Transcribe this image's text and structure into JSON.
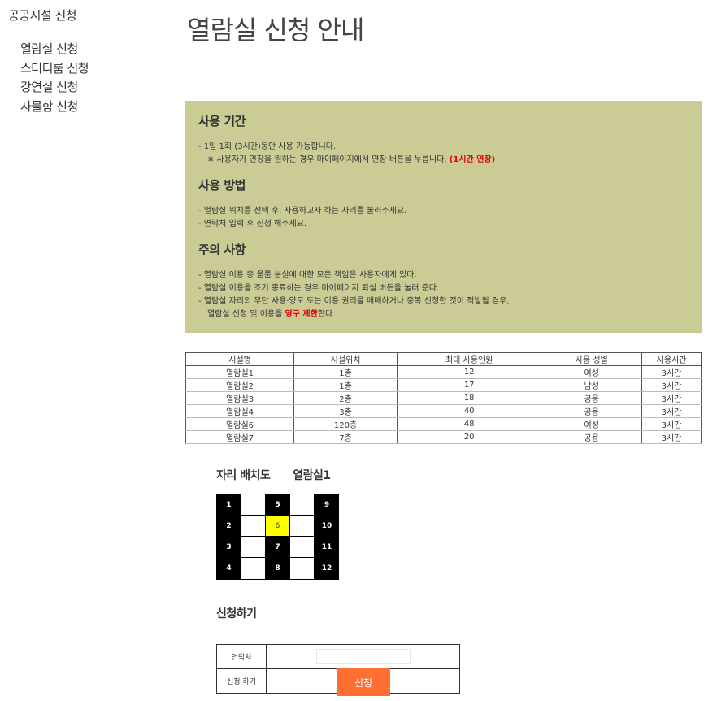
{
  "sidebar": {
    "title": "공공시설 신청",
    "items": [
      {
        "label": "열람실 신청"
      },
      {
        "label": "스터디룸 신청"
      },
      {
        "label": "강연실 신청"
      },
      {
        "label": "사물함 신청"
      }
    ]
  },
  "page": {
    "title": "열람실 신청 안내"
  },
  "info": {
    "period_title": "사용 기간",
    "period_line1": "- 1일 1회 (3시간)동안 사용 가능합니다.",
    "period_line2": "※ 사용자가 연장을 원하는 경우 마이페이지에서 연장 버튼을 누릅니다. ",
    "period_line2_red": "(1시간 연장)",
    "method_title": "사용 방법",
    "method_line1": "- 열람실 위치를 선택 후, 사용하고자 하는 자리를 눌러주세요.",
    "method_line2": "- 연락처 입력 후 신청 해주세요.",
    "caution_title": "주의 사항",
    "caution_line1": "- 열람실 이용 중 물품 분실에 대한 모든 책임은 사용자에게 있다.",
    "caution_line2": "- 열람실 이용을 조기 종료하는 경우 마이페이지 퇴실 버튼을 눌러 준다.",
    "caution_line3": "- 열람실 자리의 무단 사용·양도 또는 이용 권리를 매매하거나 중복 신청한 것이 적발될 경우,",
    "caution_line4a": "열람실 신청 및 이용을 ",
    "caution_line4_red": "영구 제한",
    "caution_line4b": "한다."
  },
  "table": {
    "headers": [
      "시설명",
      "시설위치",
      "최대 사용인원",
      "사용 성별",
      "사용시간"
    ],
    "rows": [
      [
        "열람실1",
        "1층",
        "12",
        "여성",
        "3시간"
      ],
      [
        "열람실2",
        "1층",
        "17",
        "남성",
        "3시간"
      ],
      [
        "열람실3",
        "2층",
        "18",
        "공용",
        "3시간"
      ],
      [
        "열람실4",
        "3층",
        "40",
        "공용",
        "3시간"
      ],
      [
        "열람실6",
        "120층",
        "48",
        "여성",
        "3시간"
      ],
      [
        "열람실7",
        "7층",
        "20",
        "공용",
        "3시간"
      ]
    ]
  },
  "seats": {
    "label": "자리 배치도",
    "room": "열람실1",
    "grid": [
      [
        {
          "n": "1",
          "s": "occupied"
        },
        {
          "n": "",
          "s": "empty"
        },
        {
          "n": "5",
          "s": "occupied"
        },
        {
          "n": "",
          "s": "empty"
        },
        {
          "n": "9",
          "s": "occupied"
        }
      ],
      [
        {
          "n": "2",
          "s": "occupied"
        },
        {
          "n": "",
          "s": "empty"
        },
        {
          "n": "6",
          "s": "selected"
        },
        {
          "n": "",
          "s": "empty"
        },
        {
          "n": "10",
          "s": "occupied"
        }
      ],
      [
        {
          "n": "3",
          "s": "occupied"
        },
        {
          "n": "",
          "s": "empty"
        },
        {
          "n": "7",
          "s": "occupied"
        },
        {
          "n": "",
          "s": "empty"
        },
        {
          "n": "11",
          "s": "occupied"
        }
      ],
      [
        {
          "n": "4",
          "s": "occupied"
        },
        {
          "n": "",
          "s": "empty"
        },
        {
          "n": "8",
          "s": "occupied"
        },
        {
          "n": "",
          "s": "empty"
        },
        {
          "n": "12",
          "s": "occupied"
        }
      ]
    ]
  },
  "apply": {
    "title": "신청하기",
    "contact_label": "연락처",
    "contact_value": "",
    "apply_label": "신청 하기",
    "button_label": "신청"
  },
  "colors": {
    "info_bg": "#cbcb96",
    "accent_red": "#e00000",
    "button": "#ff6f31",
    "selected_seat": "#ffff00"
  }
}
